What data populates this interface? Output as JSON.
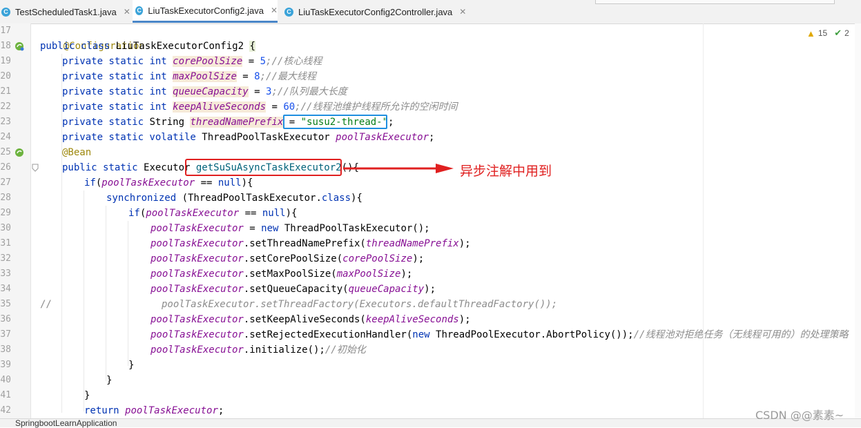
{
  "tabs": [
    {
      "label": "TestScheduledTask1.java",
      "icon": "C",
      "active": false
    },
    {
      "label": "LiuTaskExecutorConfig2.java",
      "icon": "C",
      "active": true
    },
    {
      "label": "LiuTaskExecutorConfig2Controller.java",
      "icon": "C",
      "active": false
    }
  ],
  "line_numbers": [
    "17",
    "18",
    "19",
    "20",
    "21",
    "22",
    "23",
    "24",
    "25",
    "26",
    "27",
    "28",
    "29",
    "30",
    "31",
    "32",
    "33",
    "34",
    "35",
    "36",
    "37",
    "38",
    "39",
    "40",
    "41",
    "42"
  ],
  "code": {
    "l17_annotation": "@Configuration",
    "l18_public": "public class ",
    "l18_classname": "LiuTaskExecutorConfig2 ",
    "l18_brace": "{",
    "ps": "private static ",
    "int": "int ",
    "l19_field": "corePoolSize",
    "l19_eq": " = ",
    "l19_val": "5",
    "l19_cmt": ";//核心线程",
    "l20_field": "maxPoolSize",
    "l20_val": "8",
    "l20_cmt": ";//最大线程",
    "l21_field": "queueCapacity",
    "l21_val": "3",
    "l21_cmt": ";//队列最大长度",
    "l22_field": "keepAliveSeconds",
    "l22_val": "60",
    "l22_cmt": ";//线程池维护线程所允许的空闲时间",
    "l23_type": "String ",
    "l23_field": "threadNamePrefix",
    "l23_eq": " = ",
    "l23_val": "\"susu2-thread-\"",
    "l23_semi": ";",
    "l24_mod": "private static volatile ",
    "l24_type": "ThreadPoolTaskExecutor ",
    "l24_field": "poolTaskExecutor",
    "l24_semi": ";",
    "l25_ann": "@Bean",
    "l26_mod": "public static ",
    "l26_type": "Executor ",
    "l26_method": "getSuSuAsyncTaskExecutor2",
    "l26_tail": "(){",
    "l27_if": "if",
    "l27_open": "(",
    "l27_cond": " == ",
    "l27_null": "null",
    "l27_close": "){",
    "l28_sync": "synchronized ",
    "l28_arg": "(ThreadPoolTaskExecutor.",
    "l28_class": "class",
    "l28_close": "){",
    "l30_assign": " = ",
    "l30_new": "new ",
    "l30_ctor": "ThreadPoolTaskExecutor();",
    "l31_call": ".setThreadNamePrefix(",
    "l31_arg": "threadNamePrefix",
    "close_paren": ");",
    "l32_call": ".setCorePoolSize(",
    "l32_arg": "corePoolSize",
    "l33_call": ".setMaxPoolSize(",
    "l33_arg": "maxPoolSize",
    "l34_call": ".setQueueCapacity(",
    "l34_arg": "queueCapacity",
    "l35_slashes": "//",
    "l35_cmt": "poolTaskExecutor.setThreadFactory(Executors.defaultThreadFactory());",
    "l36_call": ".setKeepAliveSeconds(",
    "l36_arg": "keepAliveSeconds",
    "l37_call": ".setRejectedExecutionHandler(",
    "l37_new": "new ",
    "l37_arg": "ThreadPoolExecutor.AbortPolicy());",
    "l37_cmt": "//线程池对拒绝任务（无线程可用的）的处理策略",
    "l38_call": ".initialize();",
    "l38_cmt": "//初始化",
    "brace_close": "}",
    "l42_return": "return ",
    "l42_field": "poolTaskExecutor",
    "l42_semi": ";"
  },
  "inspections": {
    "warnings": "15",
    "ok": "2"
  },
  "annotation_label": "异步注解中用到",
  "watermark": "CSDN @@素素~",
  "bottom_text": "SpringbootLearnApplication"
}
